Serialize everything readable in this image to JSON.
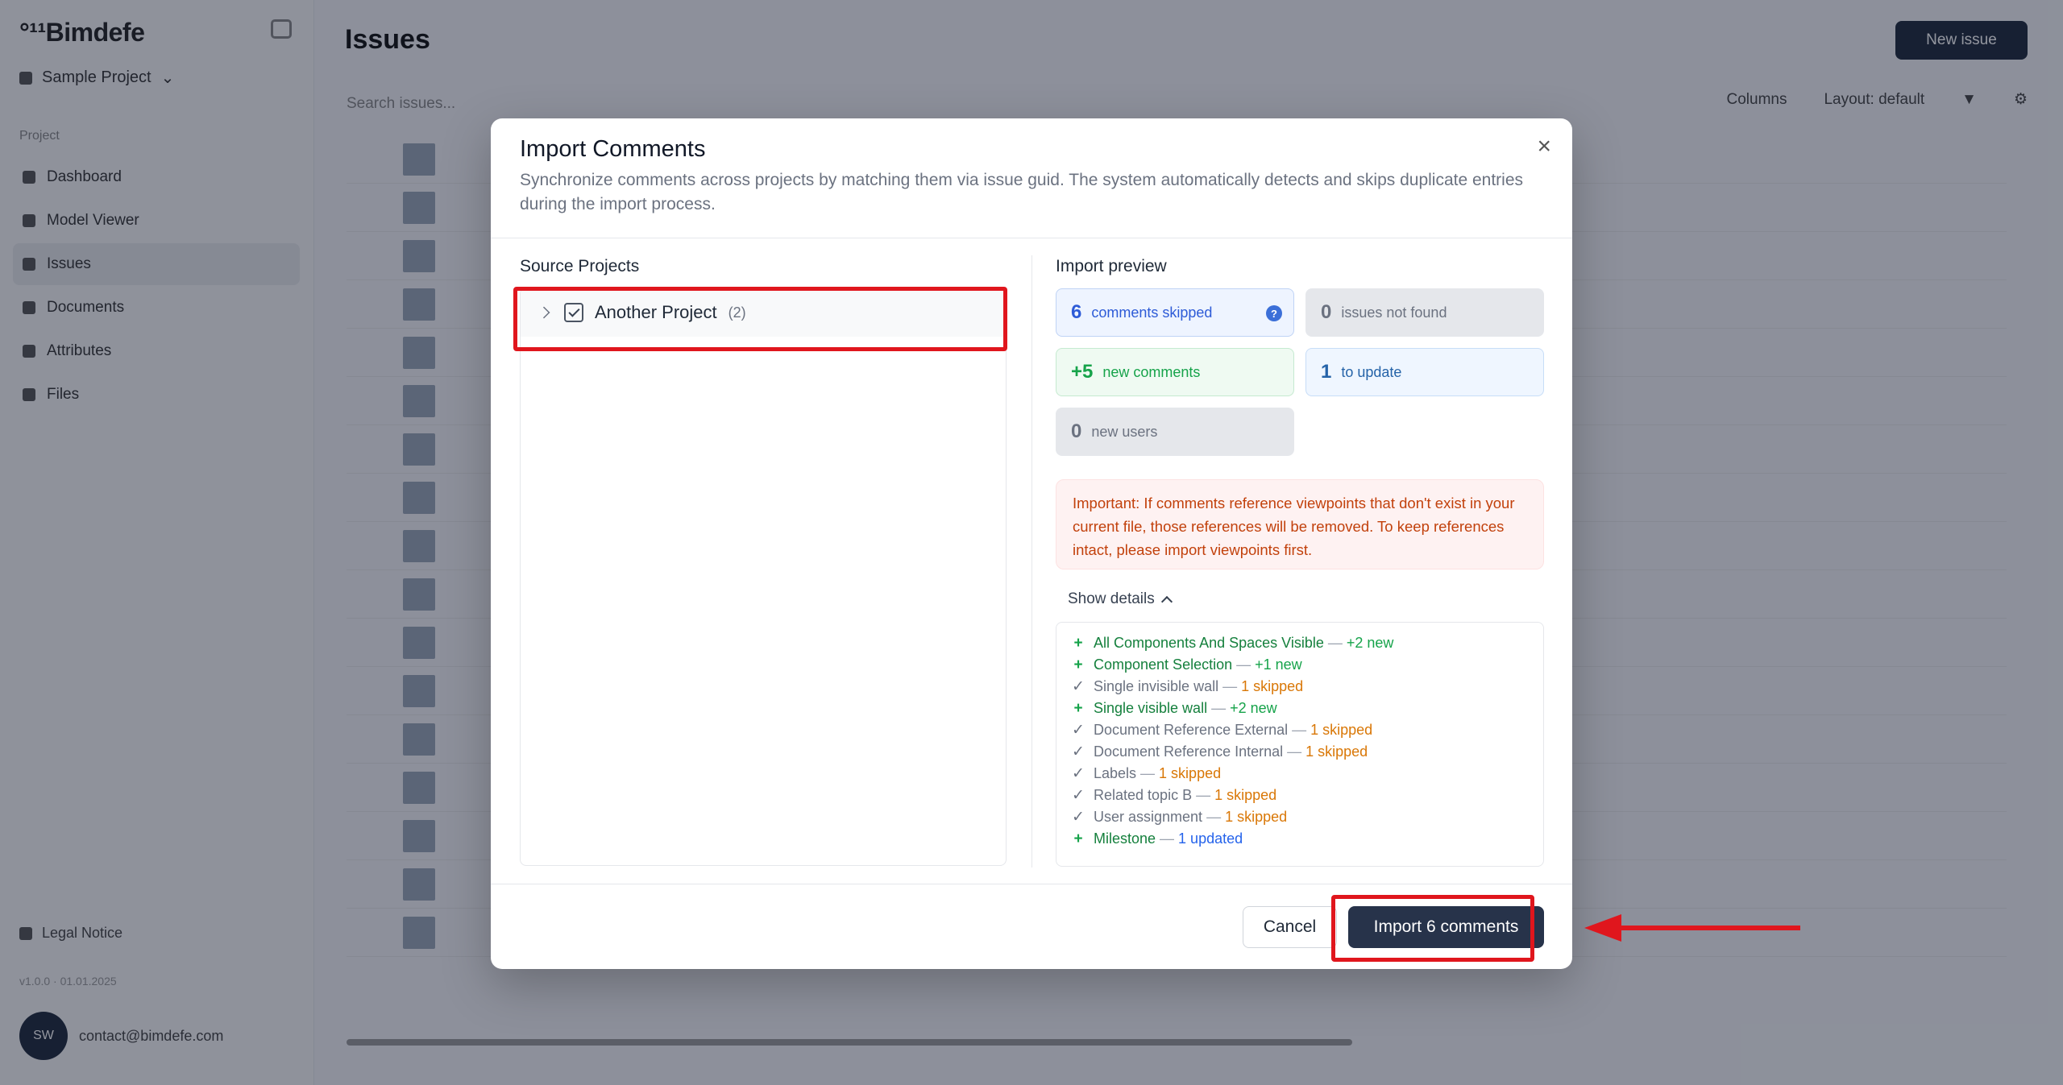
{
  "app": {
    "logo": "°¹¹Bimdefe",
    "project": "Sample Project",
    "section": "Project",
    "nav": [
      "Dashboard",
      "Model Viewer",
      "Issues",
      "Documents",
      "Attributes",
      "Files"
    ],
    "legal": "Legal Notice",
    "version": "v1.0.0 · 01.01.2025",
    "user_initials": "SW",
    "user_email": "contact@bimdefe.com"
  },
  "page": {
    "title": "Issues",
    "new_issue": "New issue",
    "search_placeholder": "Search issues...",
    "toolbar": [
      "Columns",
      "Layout: default"
    ]
  },
  "dialog": {
    "title": "Import Comments",
    "close": "×",
    "description": "Synchronize comments across projects by matching them via issue guid. The system automatically detects and skips duplicate entries during the import process.",
    "source_title": "Source Projects",
    "project": {
      "name": "Another Project",
      "count": "(2)"
    },
    "preview_title": "Import preview",
    "stats": {
      "skipped": {
        "num": "6",
        "label": "comments skipped"
      },
      "not_found": {
        "num": "0",
        "label": "issues not found"
      },
      "new_comments": {
        "num": "+5",
        "label": "new comments"
      },
      "to_update": {
        "num": "1",
        "label": "to update"
      },
      "new_users": {
        "num": "0",
        "label": "new users"
      }
    },
    "warning": "Important: If comments reference viewpoints that don't exist in your current file, those references will be removed. To keep references intact, please import viewpoints first.",
    "show_details": "Show details",
    "details": [
      {
        "kind": "new",
        "name": "All Components And Spaces Visible",
        "status": "+2 new"
      },
      {
        "kind": "new",
        "name": "Component Selection",
        "status": "+1 new"
      },
      {
        "kind": "skip",
        "name": "Single invisible wall",
        "status": "1 skipped"
      },
      {
        "kind": "new",
        "name": "Single visible wall",
        "status": "+2 new"
      },
      {
        "kind": "skip",
        "name": "Document Reference External",
        "status": "1 skipped"
      },
      {
        "kind": "skip",
        "name": "Document Reference Internal",
        "status": "1 skipped"
      },
      {
        "kind": "skip",
        "name": "Labels",
        "status": "1 skipped"
      },
      {
        "kind": "skip",
        "name": "Related topic B",
        "status": "1 skipped"
      },
      {
        "kind": "skip",
        "name": "User assignment",
        "status": "1 skipped"
      },
      {
        "kind": "upd",
        "name": "Milestone",
        "status": "1 updated"
      }
    ],
    "cancel": "Cancel",
    "import": "Import 6 comments"
  },
  "colors": {
    "primary_button": "#27334a",
    "highlight": "#e0161d",
    "new": "#16a34a",
    "skipped": "#d97706",
    "updated": "#2563eb"
  }
}
